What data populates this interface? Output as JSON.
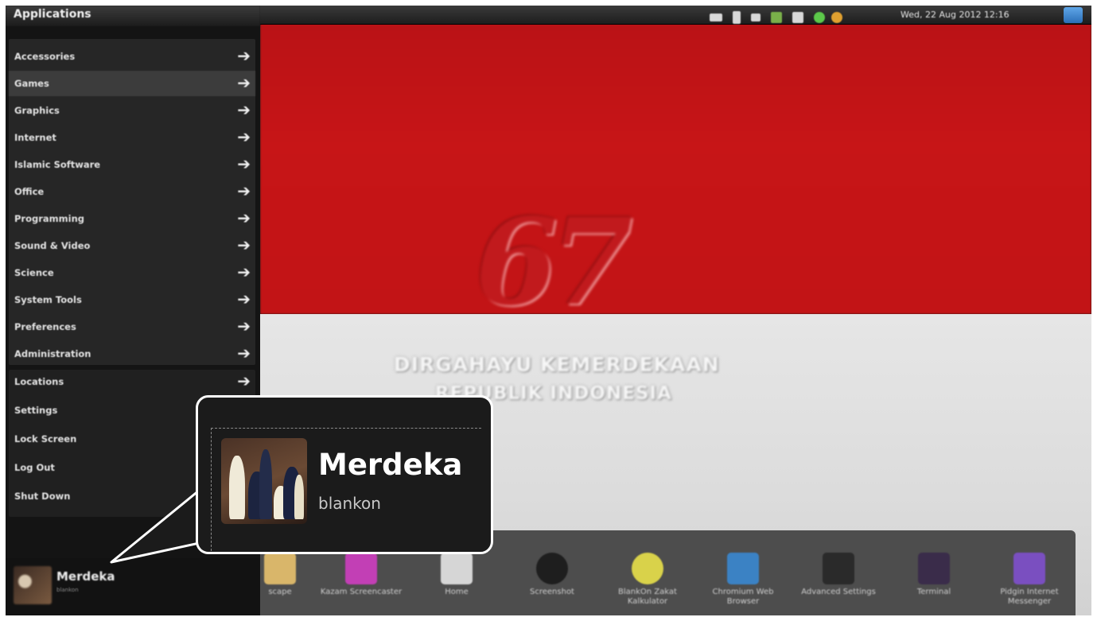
{
  "top_panel": {
    "clock": "Wed, 22 Aug 2012 12:16"
  },
  "menu": {
    "title": "Applications",
    "categories": [
      {
        "label": "Accessories"
      },
      {
        "label": "Games"
      },
      {
        "label": "Graphics"
      },
      {
        "label": "Internet"
      },
      {
        "label": "Islamic Software"
      },
      {
        "label": "Office"
      },
      {
        "label": "Programming"
      },
      {
        "label": "Sound & Video"
      },
      {
        "label": "Science"
      },
      {
        "label": "System Tools"
      },
      {
        "label": "Preferences"
      },
      {
        "label": "Administration"
      }
    ],
    "system_items": [
      {
        "label": "Locations"
      },
      {
        "label": "Settings"
      },
      {
        "label": "Lock Screen"
      },
      {
        "label": "Log Out"
      },
      {
        "label": "Shut Down"
      }
    ],
    "arrow_glyph": "➔"
  },
  "user": {
    "name": "Merdeka",
    "subtitle": "blankon"
  },
  "wallpaper": {
    "number": "67",
    "line1": "DIRGAHAYU KEMERDEKAAN",
    "line2": "REPUBLIK INDONESIA"
  },
  "dock": {
    "items": [
      {
        "label": "scape",
        "icon": "inkscape-icon",
        "color": "#d9b66a"
      },
      {
        "label": "Kazam Screencaster",
        "icon": "kazam-icon",
        "color": "#c23fb5"
      },
      {
        "label": "Home",
        "icon": "home-folder-icon",
        "color": "#d6d6d6"
      },
      {
        "label": "Screenshot",
        "icon": "screenshot-icon",
        "color": "#1e1e1e"
      },
      {
        "label": "BlankOn Zakat Kalkulator",
        "icon": "zakat-calculator-icon",
        "color": "#d9d24a"
      },
      {
        "label": "Chromium Web Browser",
        "icon": "chromium-icon",
        "color": "#3b82c4"
      },
      {
        "label": "Advanced Settings",
        "icon": "settings-gear-icon",
        "color": "#2a2a2a"
      },
      {
        "label": "Terminal",
        "icon": "terminal-icon",
        "color": "#3a2c4a"
      },
      {
        "label": "Pidgin Internet Messenger",
        "icon": "pidgin-icon",
        "color": "#7a4fc0"
      }
    ]
  },
  "colors": {
    "flag_red": "#c71517",
    "flag_white": "#e0e0e0",
    "menu_bg": "#141414",
    "callout_border": "#ffffff"
  }
}
